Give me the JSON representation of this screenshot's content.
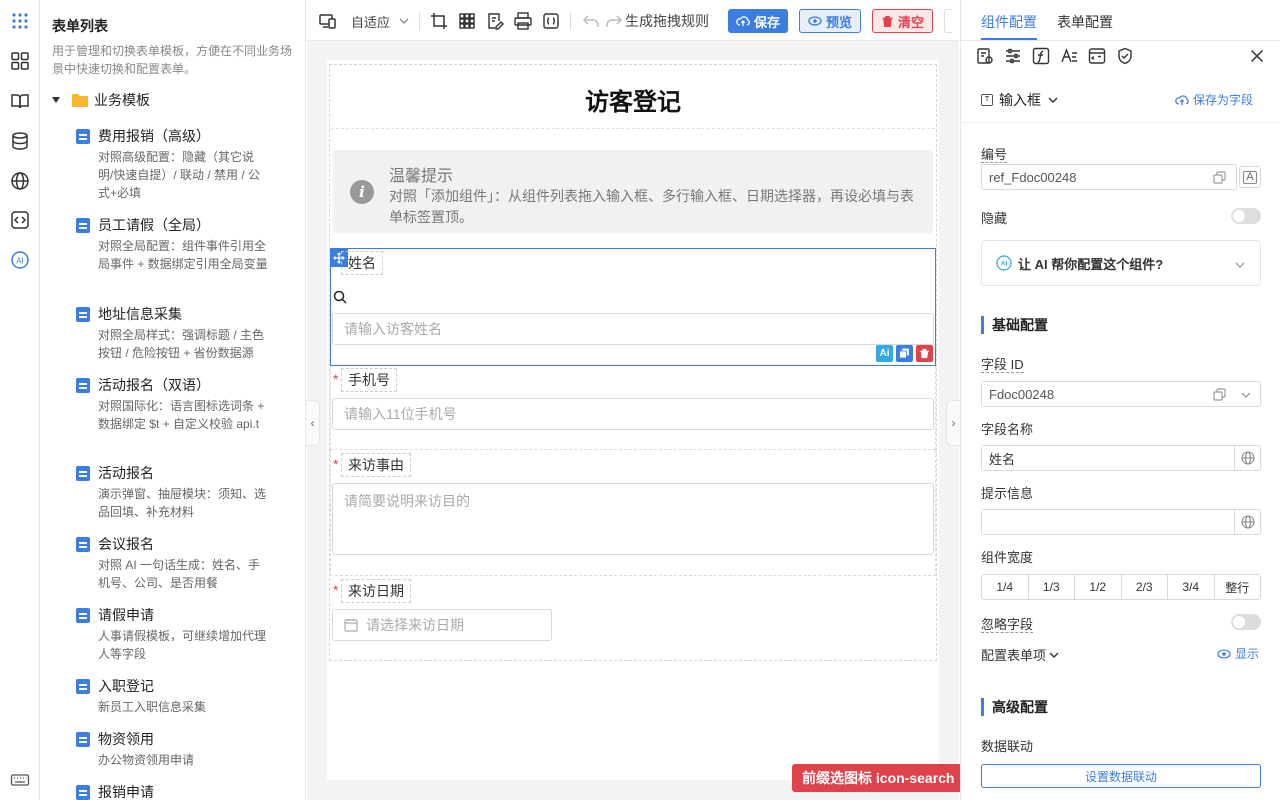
{
  "rail": {
    "icons": [
      "apps-grid-icon",
      "component-grid-icon",
      "book-icon",
      "database-icon",
      "globe-icon",
      "code-icon",
      "ai-icon",
      "keyboard-icon"
    ]
  },
  "left": {
    "title": "表单列表",
    "desc": "用于管理和切换表单模板，方便在不同业务场景中快速切换和配置表单。",
    "group": "业务模板",
    "templates": [
      {
        "name": "费用报销（高级）",
        "desc": "对照高级配置：隐藏（其它说明/快速自提）/ 联动 / 禁用 / 公式+必填"
      },
      {
        "name": "员工请假（全局）",
        "desc": "对照全局配置：组件事件引用全局事件 + 数据绑定引用全局变量"
      },
      {
        "name": "地址信息采集",
        "desc": "对照全局样式：强调标题 / 主色按钮 / 危险按钮 + 省份数据源"
      },
      {
        "name": "活动报名（双语）",
        "desc": "对照国际化：语言图标选词条 + 数据绑定 $t + 自定义校验 api.t"
      },
      {
        "name": "活动报名",
        "desc": "演示弹窗、抽屉模块：须知、选品回填、补充材料"
      },
      {
        "name": "会议报名",
        "desc": "对照 AI 一句话生成：姓名、手机号、公司、是否用餐"
      },
      {
        "name": "请假申请",
        "desc": "人事请假模板，可继续增加代理人等字段"
      },
      {
        "name": "入职登记",
        "desc": "新员工入职信息采集"
      },
      {
        "name": "物资领用",
        "desc": "办公物资领用申请"
      },
      {
        "name": "报销申请",
        "desc": ""
      }
    ]
  },
  "toolbar": {
    "adapt_label": "自适应",
    "gen_rule_label": "生成拖拽规则",
    "save_label": "保存",
    "preview_label": "预览",
    "clear_label": "清空"
  },
  "form": {
    "title": "访客登记",
    "tip_title": "温馨提示",
    "tip_content": "对照「添加组件」：从组件列表拖入输入框、多行输入框、日期选择器，再设必填与表单标签置顶。",
    "fields": [
      {
        "label": "姓名",
        "placeholder": "请输入访客姓名",
        "required": false
      },
      {
        "label": "手机号",
        "placeholder": "请输入11位手机号",
        "required": true
      },
      {
        "label": "来访事由",
        "placeholder": "请简要说明来访目的",
        "required": true
      },
      {
        "label": "来访日期",
        "placeholder": "请选择来访日期",
        "required": true
      }
    ],
    "required_mark": "*",
    "ai_badge": "Ai",
    "hint_badge": "前缀选图标 icon-search"
  },
  "right": {
    "tab_component": "组件配置",
    "tab_form": "表单配置",
    "component_type": "输入框",
    "save_as_field": "保存为字段",
    "id_label": "编号",
    "id_value": "ref_Fdoc00248",
    "hidden_label": "隐藏",
    "ai_prompt": "让 AI 帮你配置这个组件?",
    "basic_section": "基础配置",
    "field_id_label": "字段 ID",
    "field_id_value": "Fdoc00248",
    "field_name_label": "字段名称",
    "field_name_value": "姓名",
    "hint_label": "提示信息",
    "hint_value": "",
    "width_label": "组件宽度",
    "width_options": [
      "1/4",
      "1/3",
      "1/2",
      "2/3",
      "3/4",
      "整行"
    ],
    "ignore_label": "忽略字段",
    "config_items_label": "配置表单项",
    "show_label": "显示",
    "advanced_section": "高级配置",
    "linkage_label": "数据联动",
    "linkage_button": "设置数据联动"
  },
  "colors": {
    "primary": "#3b7de0",
    "danger": "#e0424b"
  }
}
